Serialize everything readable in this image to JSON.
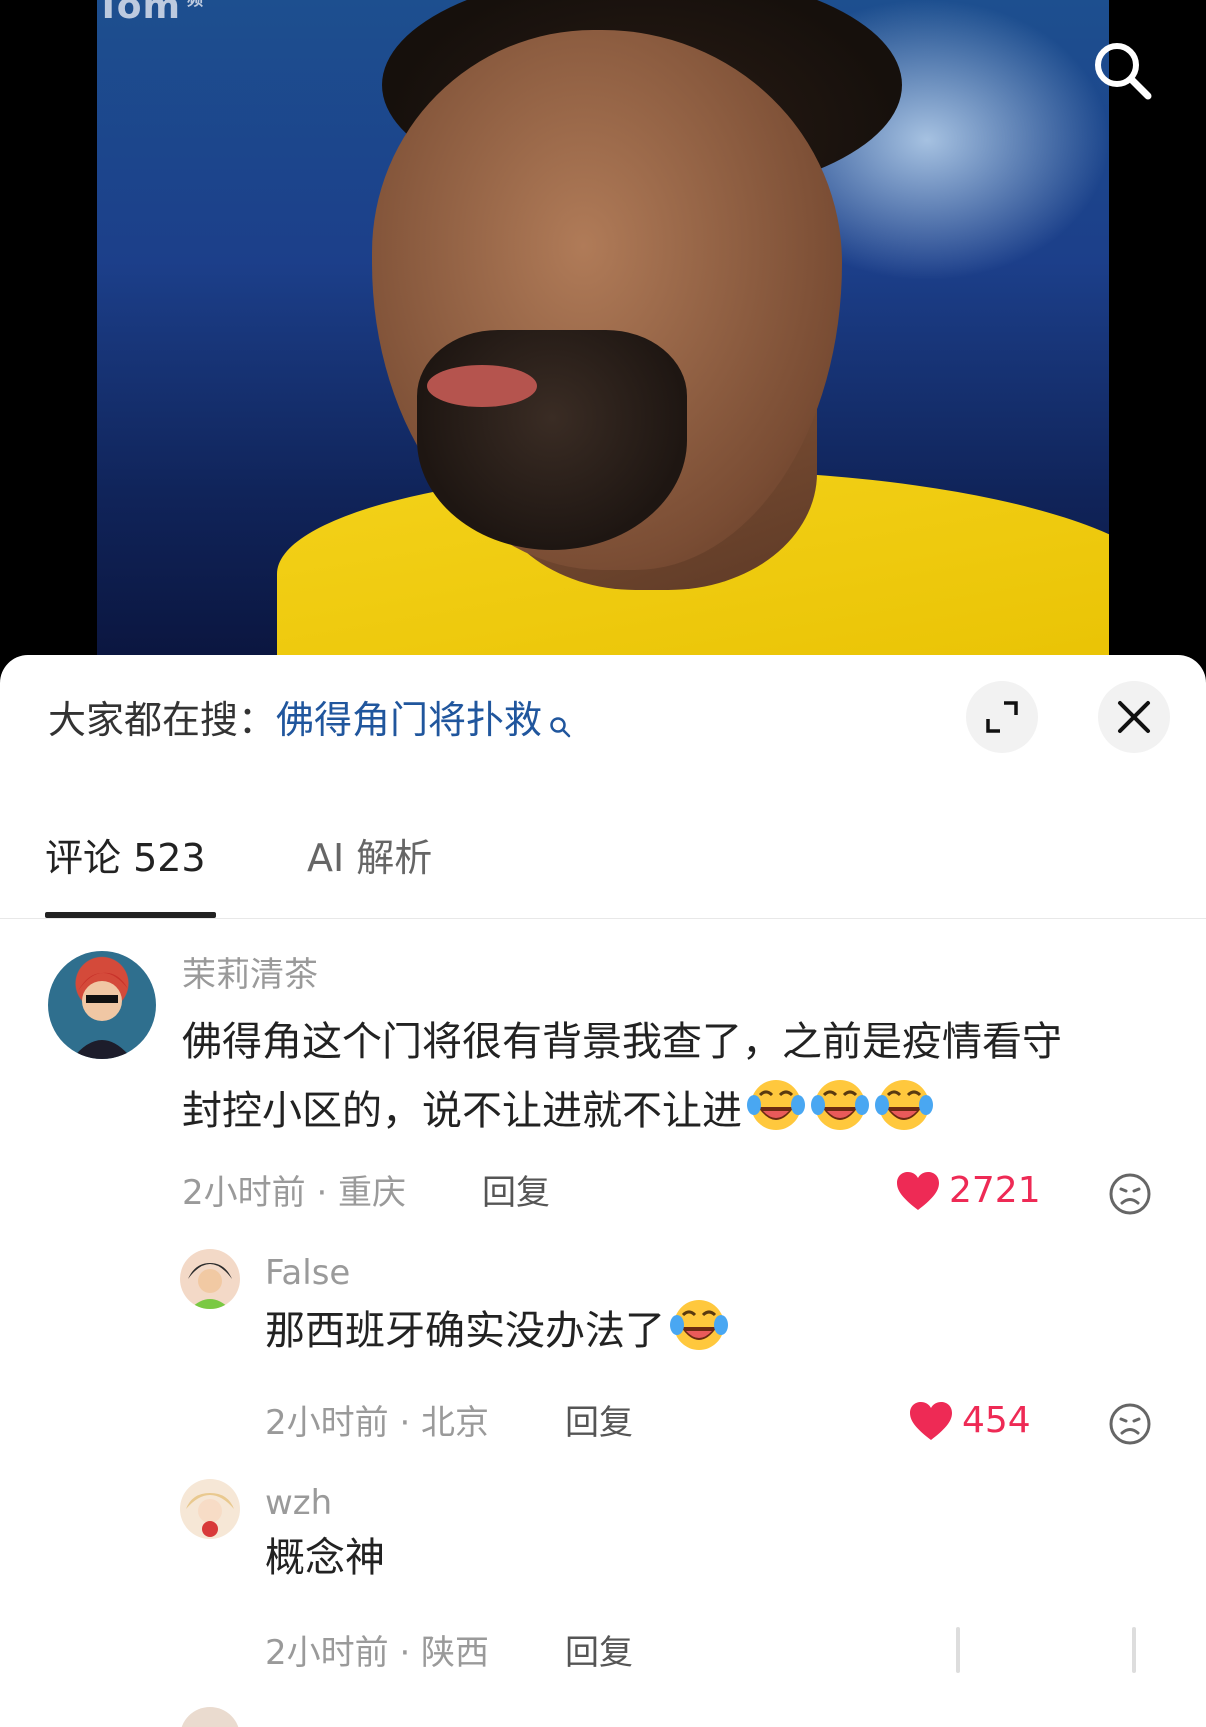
{
  "video": {
    "watermark": "Tom",
    "watermark_small": "频"
  },
  "sheet": {
    "search_prefix": "大家都在搜：",
    "search_keyword": "佛得角门将扑救",
    "tabs": [
      {
        "label": "评论 523",
        "active": true
      },
      {
        "label": "AI 解析",
        "active": false
      }
    ]
  },
  "comments": [
    {
      "user": "茉莉清茶",
      "text_line1": "佛得角这个门将很有背景我查了，之前是疫情看守",
      "text_line2": "封控小区的，说不让进就不让进",
      "emoji_count": 3,
      "time": "2小时前 · 重庆",
      "reply": "回复",
      "likes": "2721",
      "liked": true
    },
    {
      "user": "False",
      "text": "那西班牙确实没办法了",
      "emoji_count": 1,
      "time": "2小时前 · 北京",
      "reply": "回复",
      "likes": "454",
      "liked": true
    },
    {
      "user": "wzh",
      "text": "概念神",
      "time": "2小时前 · 陕西",
      "reply": "回复"
    }
  ],
  "colors": {
    "keyword": "#20569d",
    "like_red": "#ee2a55",
    "muted": "#9a9a9a"
  },
  "icons": [
    "search-icon",
    "expand-icon",
    "close-icon",
    "heart-icon",
    "dislike-face-icon",
    "laughing-crying-emoji"
  ]
}
